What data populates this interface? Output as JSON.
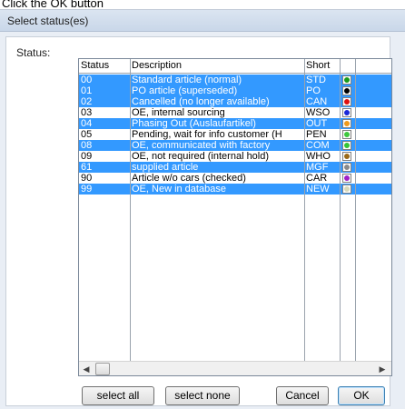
{
  "caption": "Click the OK button",
  "dialog": {
    "title": "Select status(es)",
    "status_label": "Status:"
  },
  "grid": {
    "headers": [
      "Status",
      "Description",
      "Short",
      ""
    ],
    "rows": [
      {
        "status": "00",
        "description": "Standard article (normal)",
        "short": "STD",
        "color": "#1a9b1a",
        "selected": true
      },
      {
        "status": "01",
        "description": "PO article (superseded)",
        "short": "PO",
        "color": "#000000",
        "selected": true
      },
      {
        "status": "02",
        "description": "Cancelled (no longer available)",
        "short": "CAN",
        "color": "#e01010",
        "selected": true
      },
      {
        "status": "03",
        "description": "OE, internal sourcing",
        "short": "WSO",
        "color": "#1a28d8",
        "selected": false
      },
      {
        "status": "04",
        "description": "Phasing Out (Auslaufartikel)",
        "short": "OUT",
        "color": "#f09a1a",
        "selected": true
      },
      {
        "status": "05",
        "description": "Pending, wait for info customer (H",
        "short": "PEN",
        "color": "#3ec83e",
        "selected": false
      },
      {
        "status": "08",
        "description": "OE, communicated with factory",
        "short": "COM",
        "color": "#36c436",
        "selected": true
      },
      {
        "status": "09",
        "description": "OE, not required (internal hold)",
        "short": "WHO",
        "color": "#9a6a1a",
        "selected": false
      },
      {
        "status": "61",
        "description": "supplied article",
        "short": "MGF",
        "color": "#8a8a8a",
        "selected": true
      },
      {
        "status": "90",
        "description": "Article w/o cars (checked)",
        "short": "CAR",
        "color": "#a020c8",
        "selected": false
      },
      {
        "status": "99",
        "description": "OE, New in database",
        "short": "NEW",
        "color": "#d8d8b8",
        "selected": true
      }
    ]
  },
  "buttons": {
    "select_all": "select all",
    "select_none": "select none",
    "cancel": "Cancel",
    "ok": "OK"
  },
  "scrollbar": {
    "left_arrow": "◀",
    "right_arrow": "▶"
  }
}
